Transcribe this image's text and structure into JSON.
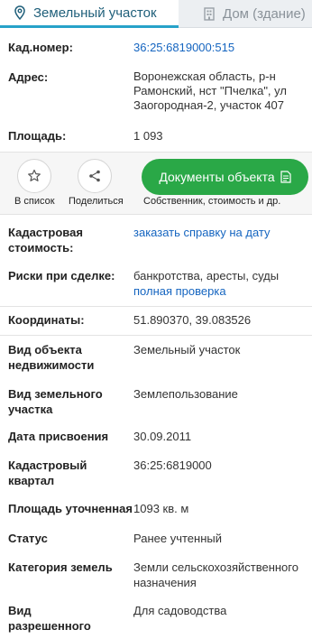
{
  "tabs": [
    {
      "label": "Земельный участок",
      "icon": "location-pin-icon",
      "active": true
    },
    {
      "label": "Дом (здание)",
      "icon": "building-icon",
      "active": false
    }
  ],
  "summary": {
    "cadastral_number": {
      "label": "Кад.номер:",
      "value": "36:25:6819000:515"
    },
    "address": {
      "label": "Адрес:",
      "value": "Воронежская область, р-н Рамонский, нст \"Пчелка\", ул Заогородная-2, участок 407"
    },
    "area": {
      "label": "Площадь:",
      "value": "1 093"
    }
  },
  "actions": {
    "favorite_label": "В список",
    "share_label": "Поделиться",
    "documents_button": "Документы объекта",
    "documents_sub": "Собственник, стоимость и др."
  },
  "details": {
    "cadastral_cost": {
      "label": "Кадастровая стоимость:",
      "link": "заказать справку на дату"
    },
    "risks": {
      "label": "Риски при сделке:",
      "value": "банкротства, аресты, суды",
      "link": "полная проверка"
    },
    "coordinates": {
      "label": "Координаты:",
      "value": "51.890370, 39.083526"
    },
    "object_type": {
      "label": "Вид объекта недвижимости",
      "value": "Земельный участок"
    },
    "land_type": {
      "label": "Вид земельного участка",
      "value": "Землепользование"
    },
    "assign_date": {
      "label": "Дата присвоения",
      "value": "30.09.2011"
    },
    "quarter": {
      "label": "Кадастровый квартал",
      "value": "36:25:6819000"
    },
    "area_refined": {
      "label": "Площадь уточненная",
      "value": "1093 кв. м"
    },
    "status": {
      "label": "Статус",
      "value": "Ранее учтенный"
    },
    "land_category": {
      "label": "Категория земель",
      "value": "Земли сельскохозяйственного назначения"
    },
    "permitted_use": {
      "label": "Вид разрешенного использования",
      "value": "Для садоводства"
    }
  },
  "colors": {
    "accent_link": "#1565c0",
    "tab_underline": "#27a2c9",
    "button_green": "#2aa847"
  }
}
